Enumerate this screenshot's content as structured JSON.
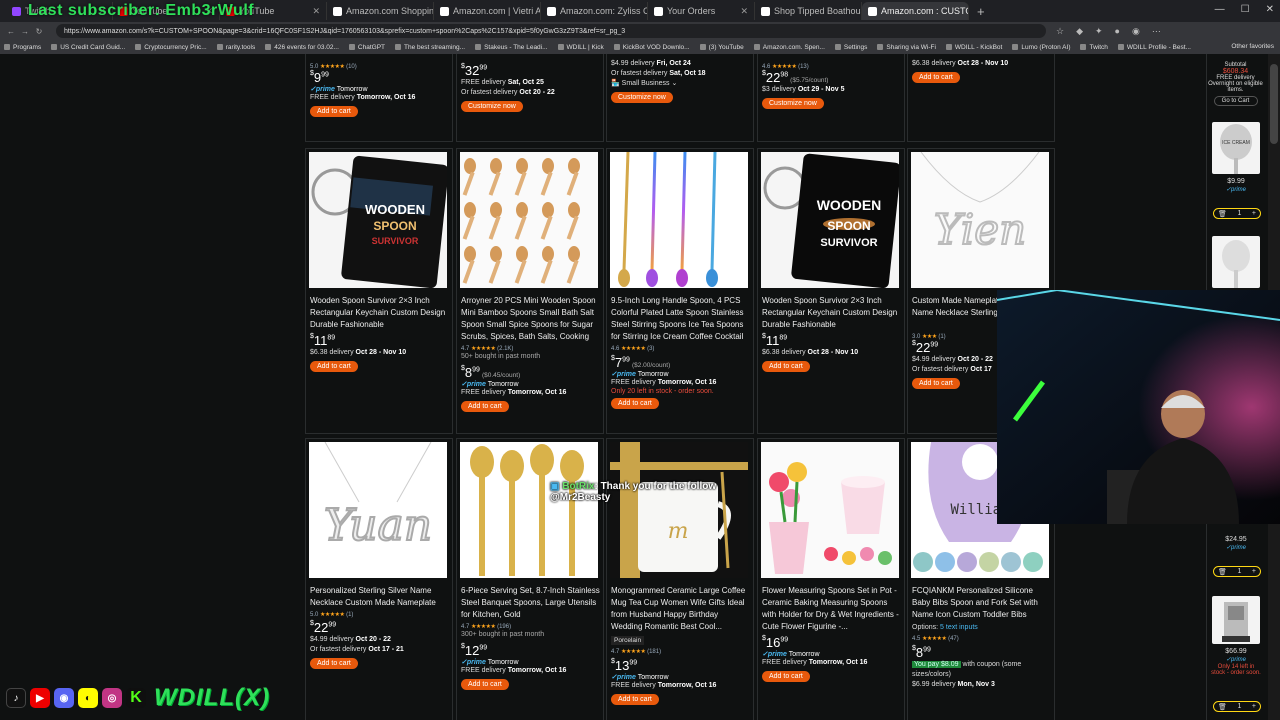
{
  "tabs": [
    {
      "label": "Twitch",
      "color": "#9146ff",
      "active": false
    },
    {
      "label": "YouTube",
      "color": "#ff0000",
      "active": false
    },
    {
      "label": "YouTube",
      "color": "#ff0000",
      "active": false
    },
    {
      "label": "Amazon.com Shopping Ca",
      "color": "#ffffff",
      "active": false
    },
    {
      "label": "Amazon.com | Vietri Aladdi",
      "color": "#ffffff",
      "active": false
    },
    {
      "label": "Amazon.com: Zyliss Classi",
      "color": "#ffffff",
      "active": false
    },
    {
      "label": "Your Orders",
      "color": "#ffffff",
      "active": false
    },
    {
      "label": "Shop Tipped Boathouse C",
      "color": "#ffffff",
      "active": false
    },
    {
      "label": "Amazon.com : CUSTOM SP",
      "color": "#ffffff",
      "active": true
    }
  ],
  "overlay_title": "Last subscriber: Emb3rWulf",
  "url": "https://www.amazon.com/s?k=CUSTOM+SPOON&page=3&crid=16QFC0SF1S2HJ&qid=1760563103&sprefix=custom+spoon%2Caps%2C157&xpid=5f0yGwG3zZ9T3&ref=sr_pg_3",
  "bookmarks": [
    "Programs",
    "US Credit Card Guid...",
    "Cryptocurrency Pric...",
    "rarity.tools",
    "426 events for 03.02...",
    "ChatGPT",
    "The best streaming...",
    "Stakeus - The Leadi...",
    "WDILL | Kick",
    "KickBot VOD Downlo...",
    "(3) YouTube",
    "Amazon.com. Spen...",
    "Settings",
    "Sharing via Wi-Fi",
    "WDILL - KickBot",
    "Lumo (Proton AI)",
    "Twitch",
    "WDILL Profile - Best..."
  ],
  "other_bookmarks": "Other favorites",
  "top_row": [
    {
      "rating": "5.0",
      "reviews": "(10)",
      "price_whole": "9",
      "price_frac": "99",
      "prime": "Tomorrow",
      "delivery": "FREE delivery",
      "delivery_date": "Tomorrow, Oct 16",
      "button": "Add to cart"
    },
    {
      "price_whole": "32",
      "price_frac": "99",
      "delivery": "FREE delivery",
      "delivery_date": "Sat, Oct 25",
      "fastest": "Or fastest delivery",
      "fastest_date": "Oct 20 - 22",
      "button": "Customize now"
    },
    {
      "delivery": "$4.99 delivery",
      "delivery_date": "Fri, Oct 24",
      "fastest": "Or fastest delivery",
      "fastest_date": "Sat, Oct 18",
      "badge": "Small Business",
      "button": "Customize now"
    },
    {
      "rating": "4.6",
      "reviews": "(13)",
      "price_whole": "22",
      "price_frac": "98",
      "per": "($5.75/count)",
      "delivery": "$3 delivery",
      "delivery_date": "Oct 29 - Nov 5",
      "button": "Customize now"
    },
    {
      "delivery": "$6.38 delivery",
      "delivery_date": "Oct 28 - Nov 10",
      "button": "Add to cart"
    }
  ],
  "middle_row": [
    {
      "title": "Wooden Spoon Survivor 2×3 Inch Rectangular Keychain Custom Design Durable Fashionable",
      "price_whole": "11",
      "price_frac": "89",
      "delivery": "$6.38 delivery",
      "delivery_date": "Oct 28 - Nov 10",
      "button": "Add to cart",
      "img_text": "WOODEN SPOON SURVIVOR"
    },
    {
      "title": "Arroyner 20 PCS Mini Wooden Spoon Mini Bamboo Spoons Small Bath Salt Spoon Small Spice Spoons for Sugar Scrubs, Spices, Bath Salts, Cooking",
      "rating": "4.7",
      "reviews": "(2.1K)",
      "bought": "50+ bought in past month",
      "price_whole": "8",
      "price_frac": "99",
      "per": "($0.45/count)",
      "prime": "Tomorrow",
      "delivery": "FREE delivery",
      "delivery_date": "Tomorrow, Oct 16",
      "button": "Add to cart"
    },
    {
      "title": "9.5-Inch Long Handle Spoon, 4 PCS Colorful Plated Latte Spoon Stainless Steel Stirring Spoons Ice Tea Spoons for Stirring Ice Cream Coffee Cocktail",
      "rating": "4.6",
      "reviews": "(3)",
      "price_whole": "7",
      "price_frac": "99",
      "per": "($2.00/count)",
      "prime": "Tomorrow",
      "delivery": "FREE delivery",
      "delivery_date": "Tomorrow, Oct 16",
      "stock": "Only 20 left in stock - order soon.",
      "button": "Add to cart"
    },
    {
      "title": "Wooden Spoon Survivor 2×3 Inch Rectangular Keychain Custom Design Durable Fashionable",
      "price_whole": "11",
      "price_frac": "89",
      "delivery": "$6.38 delivery",
      "delivery_date": "Oct 28 - Nov 10",
      "button": "Add to cart",
      "img_text": "WOODEN SPOON SURVIVOR"
    },
    {
      "title": "Custom Made Nameplate Personalized Name Necklace Sterling",
      "rating": "3.0",
      "reviews": "(1)",
      "price_whole": "22",
      "price_frac": "99",
      "delivery": "$4.99 delivery",
      "delivery_date": "Oct 20 - 22",
      "fastest": "Or fastest delivery",
      "fastest_date": "Oct 17",
      "button": "Add to cart",
      "img_text": "Yien"
    }
  ],
  "bottom_row": [
    {
      "title": "Personalized Sterling Silver Name Necklace Custom Made Nameplate",
      "rating": "5.0",
      "reviews": "(1)",
      "price_whole": "22",
      "price_frac": "99",
      "delivery": "$4.99 delivery",
      "delivery_date": "Oct 20 - 22",
      "fastest": "Or fastest delivery",
      "fastest_date": "Oct 17 - 21",
      "button": "Add to cart",
      "img_text": "Yuan"
    },
    {
      "title": "6-Piece Serving Set, 8.7-Inch Stainless Steel Banquet Spoons, Large Utensils for Kitchen, Gold",
      "rating": "4.7",
      "reviews": "(196)",
      "bought": "300+ bought in past month",
      "price_whole": "12",
      "price_frac": "99",
      "prime": "Tomorrow",
      "delivery": "FREE delivery",
      "delivery_date": "Tomorrow, Oct 16",
      "button": "Add to cart"
    },
    {
      "title": "Monogrammed Ceramic Large Coffee Mug Tea Cup Women Wife Gifts Ideal from Husband Happy Birthday Wedding Romantic Best Cool...",
      "material": "Porcelain",
      "rating": "4.7",
      "reviews": "(181)",
      "price_whole": "13",
      "price_frac": "99",
      "prime": "Tomorrow",
      "delivery": "FREE delivery",
      "delivery_date": "Tomorrow, Oct 16",
      "button": "Add to cart",
      "img_text": "m"
    },
    {
      "title": "Flower Measuring Spoons Set in Pot - Ceramic Baking Measuring Spoons with Holder for Dry & Wet Ingredients - Cute Flower Figurine -...",
      "price_whole": "16",
      "price_frac": "99",
      "prime": "Tomorrow",
      "delivery": "FREE delivery",
      "delivery_date": "Tomorrow, Oct 16",
      "button": "Add to cart"
    },
    {
      "title": "FCQIANKM Personalized Silicone Baby Bibs Spoon and Fork Set with Name Icon Custom Toddler Bibs Personalized Baby Gifts",
      "options": "Options:",
      "options_link": "5 text inputs",
      "rating": "4.5",
      "reviews": "(47)",
      "price_whole": "8",
      "price_frac": "99",
      "coupon": "You pay $8.09",
      "coupon_rest": "with coupon (some sizes/colors)",
      "delivery": "$6.99 delivery",
      "delivery_date": "Mon, Nov 3",
      "img_text": "William"
    }
  ],
  "cart": {
    "subtotal_label": "Subtotal",
    "subtotal": "$608.34",
    "free_delivery": "FREE delivery",
    "overnight": "Overnight on eligible items.",
    "go_to_cart": "Go to Cart",
    "items": [
      {
        "price": "$9.99",
        "qty": "1"
      },
      {
        "price": "$24.95",
        "qty": "1"
      },
      {
        "price": "$66.99",
        "qty": "1",
        "stock": "Only 14 left in stock - order soon."
      }
    ]
  },
  "chat": {
    "user": "BotRix",
    "message": ": Thank you for the follow",
    "mention": "@Mr2Beasty"
  },
  "stream_handle": "WDILL(X)",
  "social_icons": [
    "tiktok-icon",
    "youtube-icon",
    "discord-icon",
    "snapchat-icon",
    "instagram-icon",
    "kick-icon"
  ]
}
